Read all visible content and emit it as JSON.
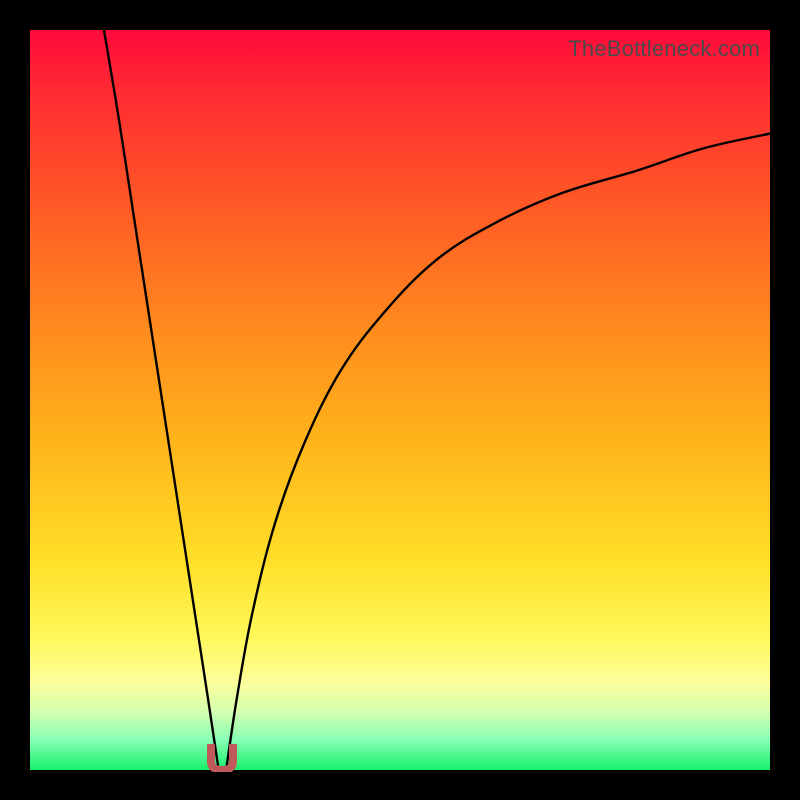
{
  "watermark": "TheBottleneck.com",
  "chart_data": {
    "type": "line",
    "title": "",
    "xlabel": "",
    "ylabel": "",
    "xlim": [
      0,
      100
    ],
    "ylim": [
      0,
      100
    ],
    "grid": false,
    "legend": false,
    "notes": "Two black curves plunging from the top toward a common minimum near x≈26, y≈0, then the right curve rises asymptotically toward ~86% at x=100. Background is a vertical red→yellow→green gradient. A small red U-shaped marker sits at the minimum on the baseline.",
    "series": [
      {
        "name": "left-branch",
        "x": [
          10,
          12,
          14,
          16,
          18,
          20,
          22,
          24,
          25.5
        ],
        "y": [
          100,
          88,
          75,
          62,
          49,
          36,
          23,
          10,
          0
        ]
      },
      {
        "name": "right-branch",
        "x": [
          26.5,
          28,
          30,
          33,
          37,
          42,
          48,
          55,
          63,
          72,
          82,
          91,
          100
        ],
        "y": [
          0,
          10,
          21,
          33,
          44,
          54,
          62,
          69,
          74,
          78,
          81,
          84,
          86
        ]
      }
    ],
    "marker": {
      "x": 26,
      "y": 0,
      "color": "#c05a5a"
    }
  }
}
